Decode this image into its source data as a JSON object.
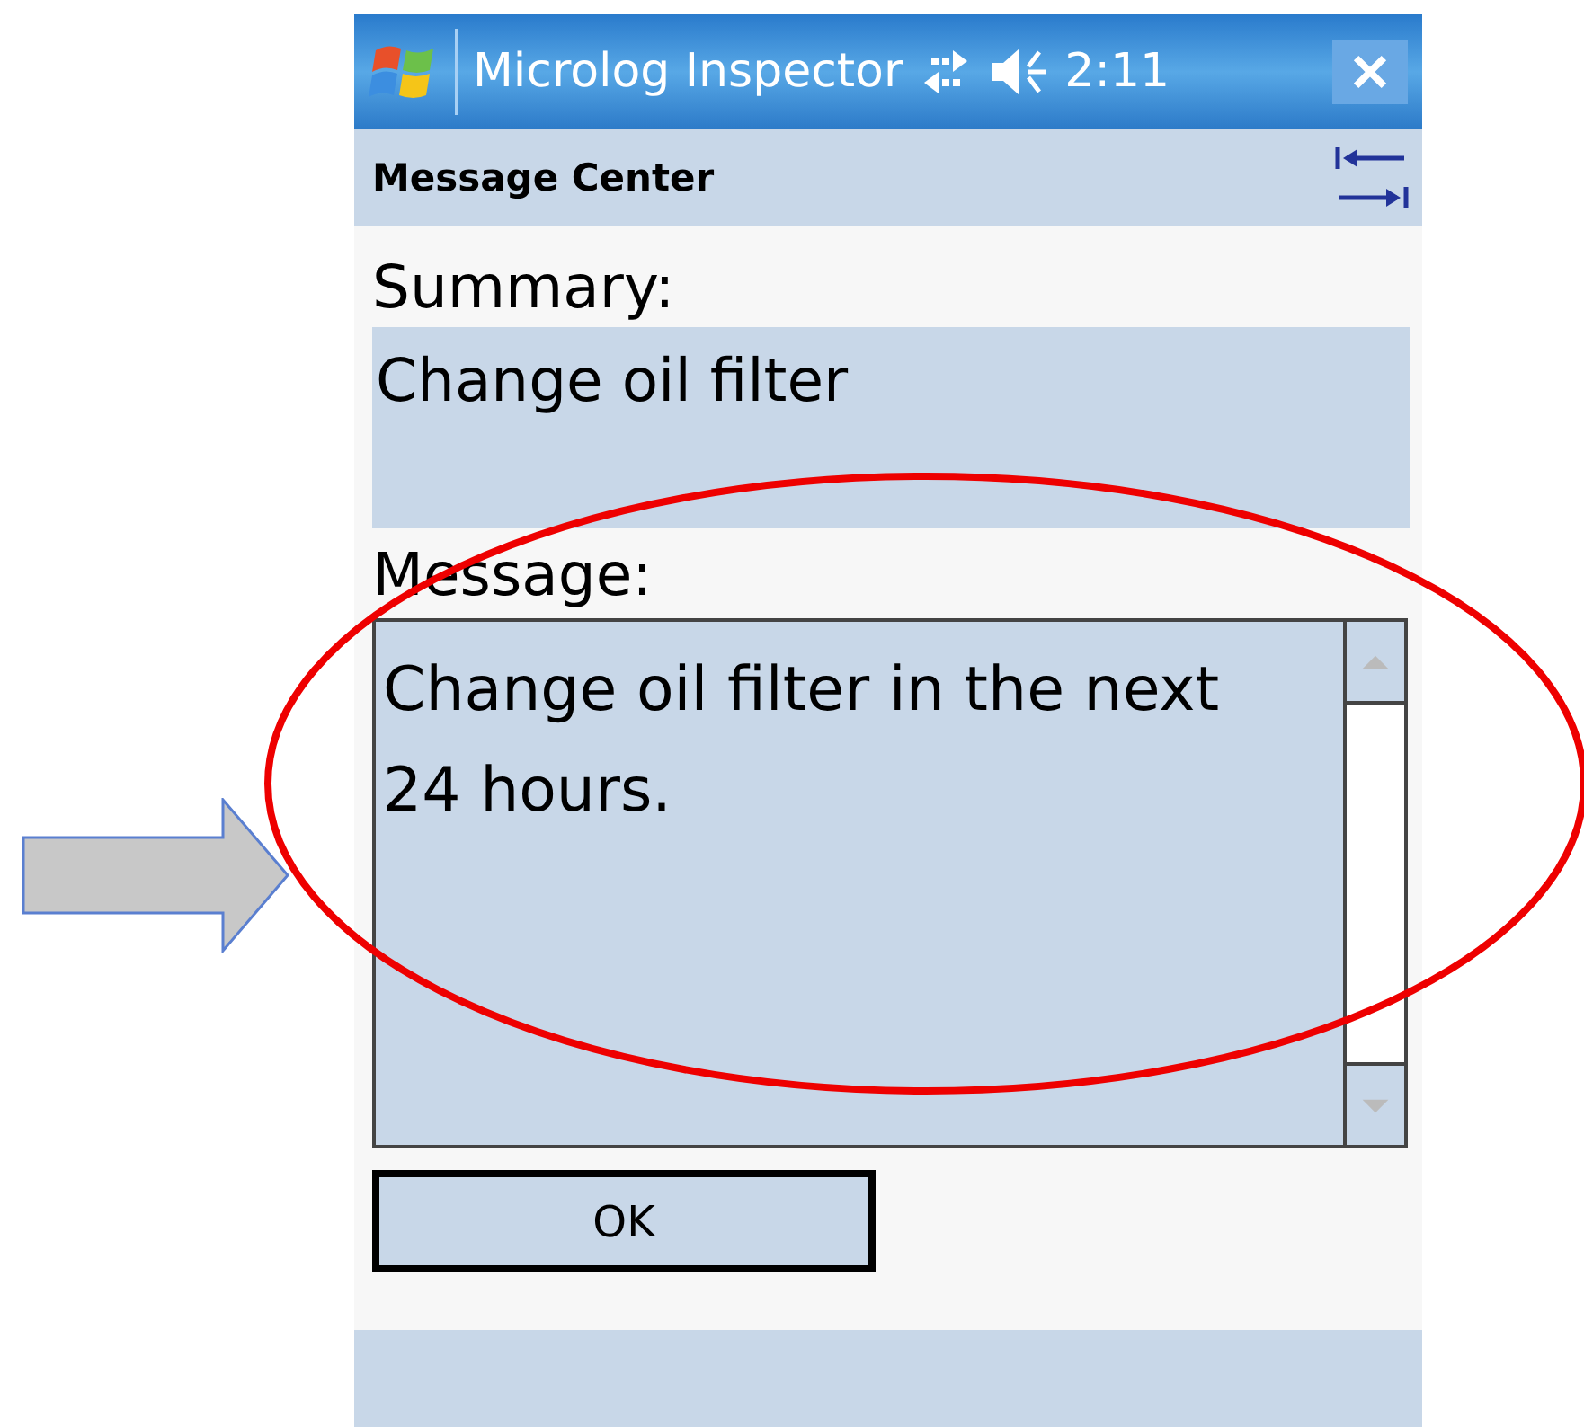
{
  "window": {
    "title": "Microlog Inspector",
    "time": "2:11"
  },
  "header": {
    "title": "Message Center"
  },
  "summary": {
    "label": "Summary:",
    "value": "Change oil filter"
  },
  "message": {
    "label": "Message:",
    "value": "Change oil filter in the next 24 hours."
  },
  "buttons": [
    {
      "label": "OK"
    }
  ]
}
